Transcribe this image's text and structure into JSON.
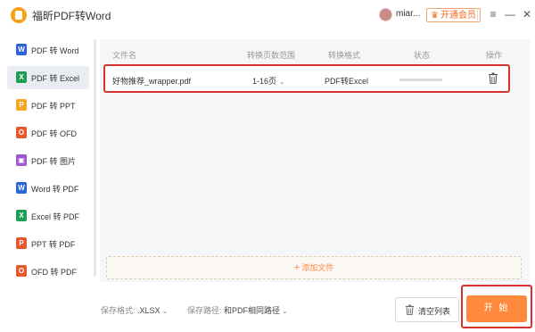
{
  "app": {
    "title": "福昕PDF转Word",
    "logo_icon": "foxit-logo-icon"
  },
  "titlebar": {
    "username": "miar...",
    "vip_label": "开通会员",
    "menu_icon": "menu-icon",
    "minimize_icon": "minimize-icon",
    "close_icon": "close-icon"
  },
  "sidebar": {
    "items": [
      {
        "label": "PDF 转 Word",
        "icon": "word-icon",
        "glyph": "W",
        "color": "#2b64d8",
        "active": false
      },
      {
        "label": "PDF 转 Excel",
        "icon": "excel-icon",
        "glyph": "X",
        "color": "#1f9d55",
        "active": true
      },
      {
        "label": "PDF 转 PPT",
        "icon": "ppt-icon",
        "glyph": "P",
        "color": "#f5a623",
        "active": false
      },
      {
        "label": "PDF 转 OFD",
        "icon": "ofd-icon",
        "glyph": "O",
        "color": "#e8572c",
        "active": false
      },
      {
        "label": "PDF 转 图片",
        "icon": "image-icon",
        "glyph": "▣",
        "color": "#9b59d0",
        "active": false
      },
      {
        "label": "Word 转 PDF",
        "icon": "word-to-pdf-icon",
        "glyph": "W",
        "color": "#2b64d8",
        "active": false
      },
      {
        "label": "Excel 转 PDF",
        "icon": "excel-to-pdf-icon",
        "glyph": "X",
        "color": "#1f9d55",
        "active": false
      },
      {
        "label": "PPT 转 PDF",
        "icon": "ppt-to-pdf-icon",
        "glyph": "P",
        "color": "#e8572c",
        "active": false
      },
      {
        "label": "OFD 转 PDF",
        "icon": "ofd-to-pdf-icon",
        "glyph": "O",
        "color": "#e8572c",
        "active": false
      }
    ]
  },
  "table": {
    "headers": [
      "文件名",
      "转换页数范围",
      "转换格式",
      "状态",
      "操作"
    ],
    "rows": [
      {
        "filename": "好物推荐_wrapper.pdf",
        "range": "1-16页",
        "format": "PDF转Excel",
        "progress": 0
      }
    ]
  },
  "add_file_label": "添加文件",
  "footer": {
    "format_label": "保存格式:",
    "format_value": ".XLSX",
    "path_label": "保存路径:",
    "path_value": "和PDF相同路径",
    "clear_label": "清空列表",
    "start_label": "开 始"
  },
  "colors": {
    "accent": "#ff8a3d",
    "highlight": "#d9322e",
    "active_bg": "#e9edf3"
  }
}
